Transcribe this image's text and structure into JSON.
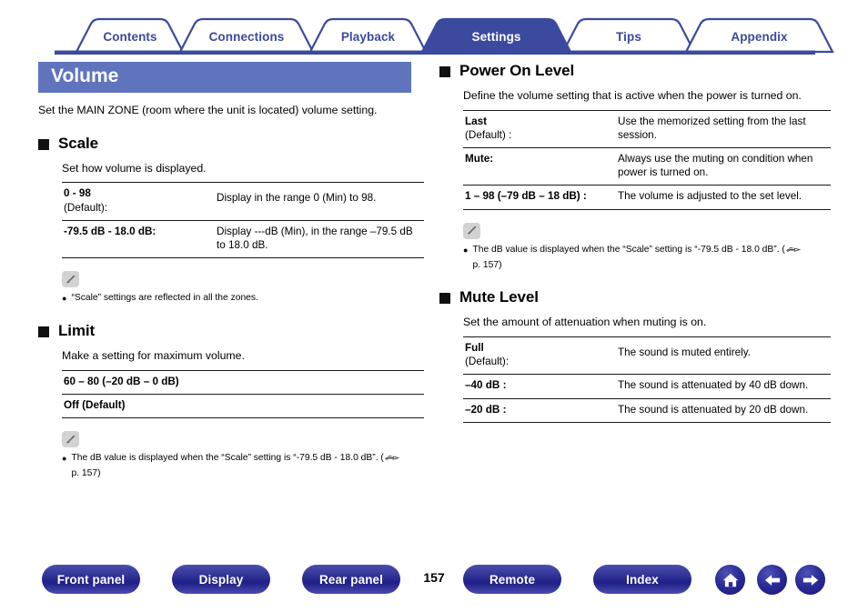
{
  "tabs": [
    {
      "label": "Contents",
      "active": false
    },
    {
      "label": "Connections",
      "active": false
    },
    {
      "label": "Playback",
      "active": false
    },
    {
      "label": "Settings",
      "active": true
    },
    {
      "label": "Tips",
      "active": false
    },
    {
      "label": "Appendix",
      "active": false
    }
  ],
  "page": {
    "title": "Volume",
    "intro": "Set the MAIN ZONE (room where the unit is located) volume setting.",
    "number": "157"
  },
  "colors": {
    "title_bar": "#5f74bd",
    "tab_text": "#3b4a9e",
    "tab_active_bg": "#3b4a9e",
    "button_blue": "#2e2f93"
  },
  "sections": {
    "scale": {
      "title": "Scale",
      "desc": "Set how volume is displayed.",
      "rows": [
        {
          "key": "0 - 98",
          "key2": "(Default):",
          "value": "Display in the range 0 (Min) to 98."
        },
        {
          "key": "-79.5 dB - 18.0 dB:",
          "key2": "",
          "value": "Display ---dB (Min), in the range –79.5 dB to 18.0 dB."
        }
      ],
      "note": "“Scale” settings are reflected in all the zones."
    },
    "limit": {
      "title": "Limit",
      "desc": "Make a setting for maximum volume.",
      "rows": [
        {
          "full": "60 – 80 (–20 dB – 0 dB)",
          "normal": ""
        },
        {
          "full": "Off",
          "normal": " (Default)"
        }
      ],
      "note_pre": "The dB value is displayed when the “Scale” setting is “-79.5 dB - 18.0 dB”. (",
      "note_post": " p. 157)"
    },
    "power_on_level": {
      "title": "Power On Level",
      "desc": "Define the volume setting that is active when the power is turned on.",
      "rows": [
        {
          "key": "Last",
          "key2": "(Default) :",
          "value": "Use the memorized setting from the last session."
        },
        {
          "key": "Mute:",
          "key2": "",
          "value": "Always use the muting on condition when power is turned on."
        },
        {
          "key": "1 – 98 (–79 dB – 18 dB) :",
          "key2": "",
          "value": "The volume is adjusted to the set level."
        }
      ],
      "note_pre": "The dB value is displayed when the “Scale” setting is “-79.5 dB - 18.0 dB”. (",
      "note_post": " p. 157)"
    },
    "mute_level": {
      "title": "Mute Level",
      "desc": "Set the amount of attenuation when muting is on.",
      "rows": [
        {
          "key": "Full",
          "key2": "(Default):",
          "value": "The sound is muted entirely."
        },
        {
          "key": "–40 dB :",
          "key2": "",
          "value": "The sound is attenuated by 40 dB down."
        },
        {
          "key": "–20 dB :",
          "key2": "",
          "value": "The sound is attenuated by 20 dB down."
        }
      ]
    }
  },
  "footer": {
    "buttons": [
      {
        "label": "Front panel"
      },
      {
        "label": "Display"
      },
      {
        "label": "Rear panel"
      },
      {
        "label": "Remote"
      },
      {
        "label": "Index"
      }
    ],
    "icons": [
      {
        "name": "home-icon"
      },
      {
        "name": "arrow-left-icon"
      },
      {
        "name": "arrow-right-icon"
      }
    ]
  }
}
